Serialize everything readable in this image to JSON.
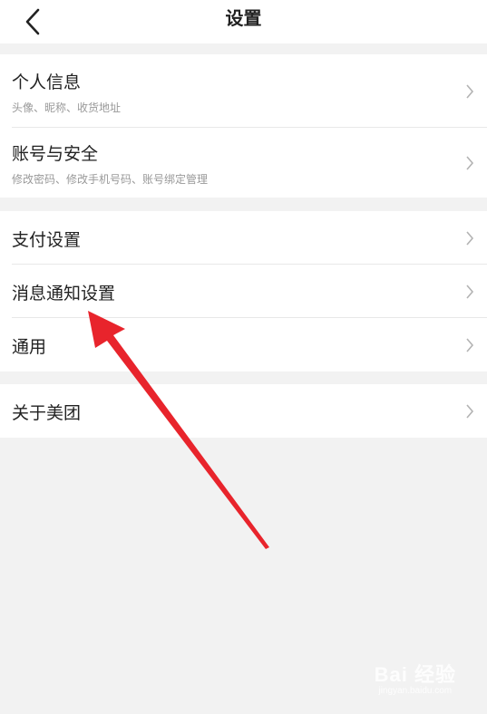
{
  "header": {
    "title": "设置",
    "back_icon": "chevron-left-icon"
  },
  "groups": [
    {
      "items": [
        {
          "title": "个人信息",
          "subtitle": "头像、昵称、收货地址"
        },
        {
          "title": "账号与安全",
          "subtitle": "修改密码、修改手机号码、账号绑定管理"
        }
      ]
    },
    {
      "items": [
        {
          "title": "支付设置"
        },
        {
          "title": "消息通知设置"
        },
        {
          "title": "通用"
        }
      ]
    },
    {
      "items": [
        {
          "title": "关于美团"
        }
      ]
    }
  ],
  "annotation": {
    "color": "#e8242c"
  },
  "watermark": {
    "main": "Bai 经验",
    "sub": "jingyan.baidu.com"
  },
  "colors": {
    "background": "#f2f2f2",
    "surface": "#ffffff",
    "text": "#222222",
    "subtext": "#999999",
    "chevron": "#b3b3b3"
  }
}
